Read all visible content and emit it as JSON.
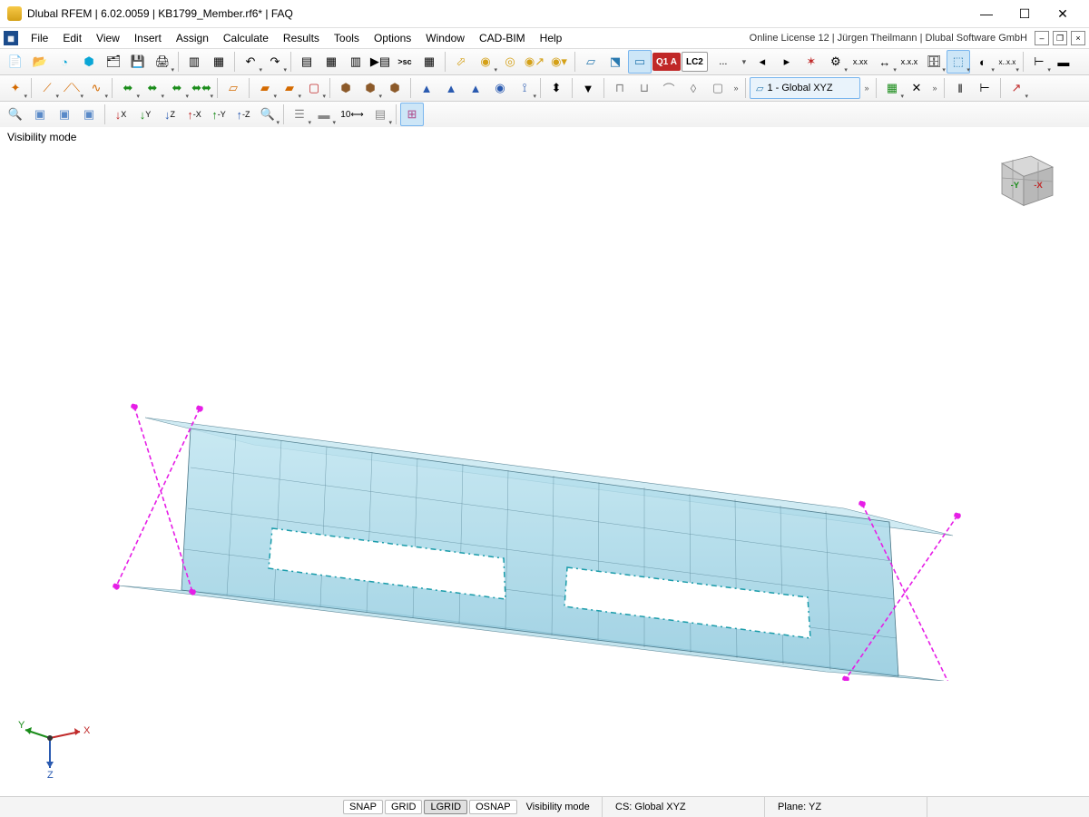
{
  "title": "Dlubal RFEM | 6.02.0059 | KB1799_Member.rf6* | FAQ",
  "menu": {
    "items": [
      "File",
      "Edit",
      "View",
      "Insert",
      "Assign",
      "Calculate",
      "Results",
      "Tools",
      "Options",
      "Window",
      "CAD-BIM",
      "Help"
    ]
  },
  "license_info": "Online License 12 | Jürgen Theilmann | Dlubal Software GmbH",
  "loadcase": {
    "badge1": "Q1 A",
    "badge2": "LC2",
    "dots": "..."
  },
  "coord_system": "1 - Global XYZ",
  "viewport": {
    "label": "Visibility mode"
  },
  "cube": {
    "face_y": "-Y",
    "face_x": "-X"
  },
  "gizmo": {
    "x": "X",
    "y": "Y",
    "z": "Z"
  },
  "status": {
    "snap": "SNAP",
    "grid": "GRID",
    "lgrid": "LGRID",
    "osnap": "OSNAP",
    "mode": "Visibility mode",
    "cs": "CS: Global XYZ",
    "plane": "Plane: YZ"
  },
  "tb_num": "10"
}
